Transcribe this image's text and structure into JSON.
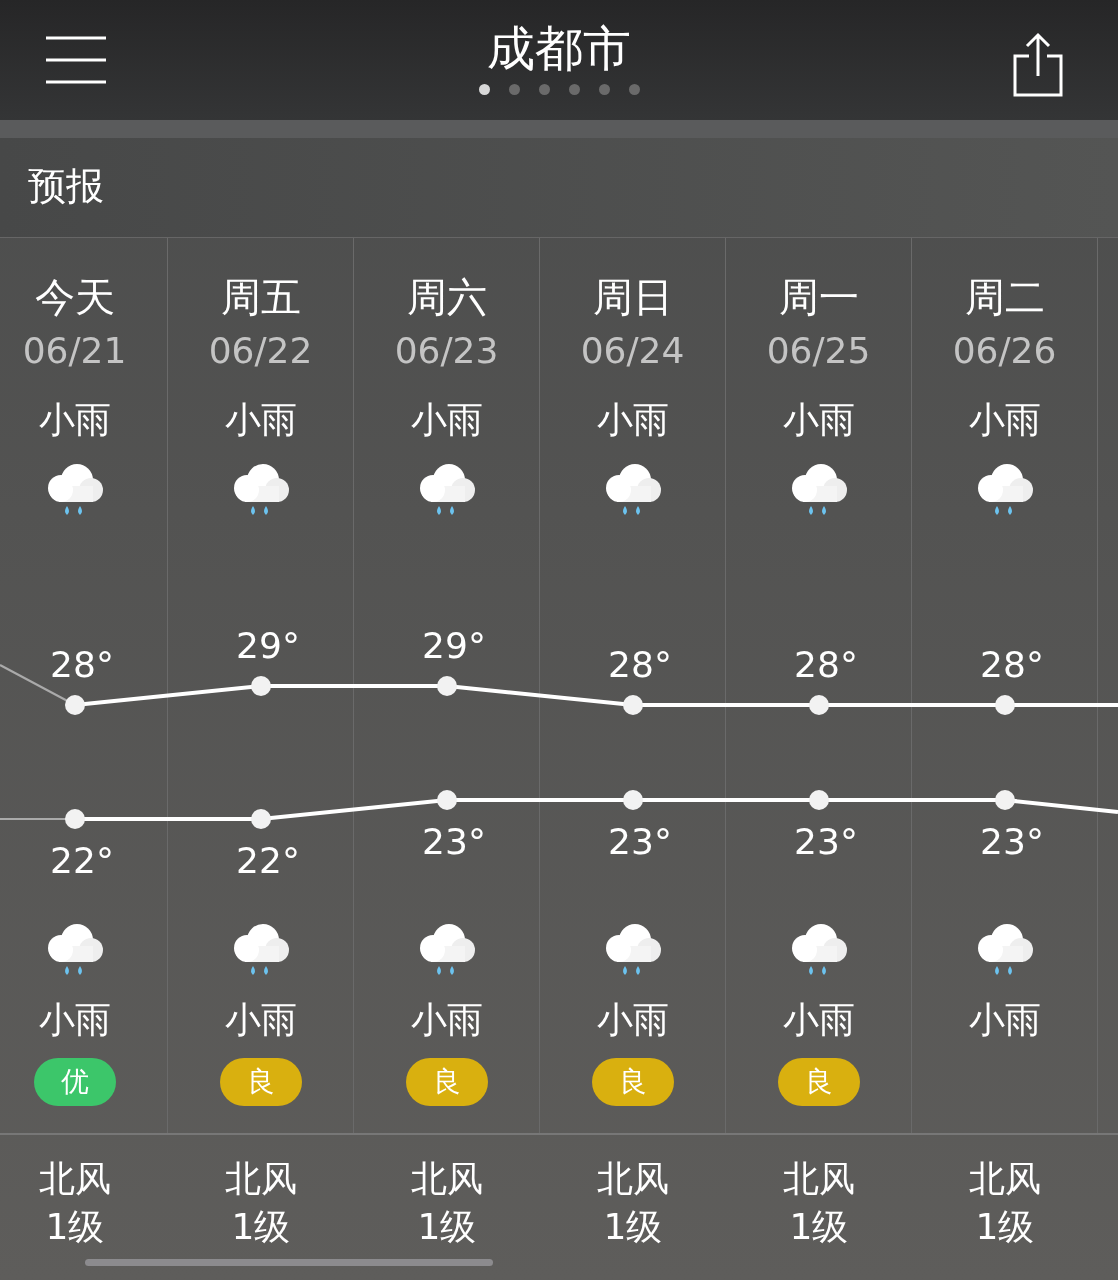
{
  "header": {
    "title": "成都市",
    "pages": [
      {
        "selected": true
      },
      {
        "selected": false
      },
      {
        "selected": false
      },
      {
        "selected": false
      },
      {
        "selected": false
      },
      {
        "selected": false
      }
    ]
  },
  "section_title": "预报",
  "days": [
    {
      "day": "今天",
      "day_condition": "小雨",
      "night_condition": "小雨",
      "aqi": {
        "label": "优",
        "color": "#3cc66a"
      },
      "wind": "北风",
      "wind_level": "1级"
    },
    {
      "day": "周五",
      "day_condition": "小雨",
      "night_condition": "小雨",
      "aqi": {
        "label": "良",
        "color": "#d9b00f"
      },
      "wind": "北风",
      "wind_level": "1级"
    },
    {
      "day": "周六",
      "day_condition": "小雨",
      "night_condition": "小雨",
      "aqi": {
        "label": "良",
        "color": "#d9b00f"
      },
      "wind": "北风",
      "wind_level": "1级"
    },
    {
      "day": "周日",
      "day_condition": "小雨",
      "night_condition": "小雨",
      "aqi": {
        "label": "良",
        "color": "#d9b00f"
      },
      "wind": "北风",
      "wind_level": "1级"
    },
    {
      "day": "周一",
      "day_condition": "小雨",
      "night_condition": "小雨",
      "aqi": {
        "label": "良",
        "color": "#d9b00f"
      },
      "wind": "北风",
      "wind_level": "1级"
    },
    {
      "day": "周二",
      "day_condition": "小雨",
      "night_condition": "小雨",
      "wind": "北风",
      "wind_level": "1级"
    }
  ],
  "chart_data": {
    "type": "line",
    "categories": [
      "06/21",
      "06/22",
      "06/23",
      "06/24",
      "06/25",
      "06/26"
    ],
    "series": [
      {
        "color": "#ffffff",
        "marker": "circle",
        "values": [
          28,
          29,
          29,
          28,
          28,
          28
        ],
        "value_labels": [
          "28°",
          "29°",
          "29°",
          "28°",
          "28°",
          "28°"
        ]
      },
      {
        "color": "#ffffff",
        "marker": "circle",
        "values": [
          22,
          22,
          23,
          23,
          23,
          23
        ],
        "value_labels": [
          "22°",
          "22°",
          "23°",
          "23°",
          "23°",
          "23°"
        ]
      }
    ]
  }
}
